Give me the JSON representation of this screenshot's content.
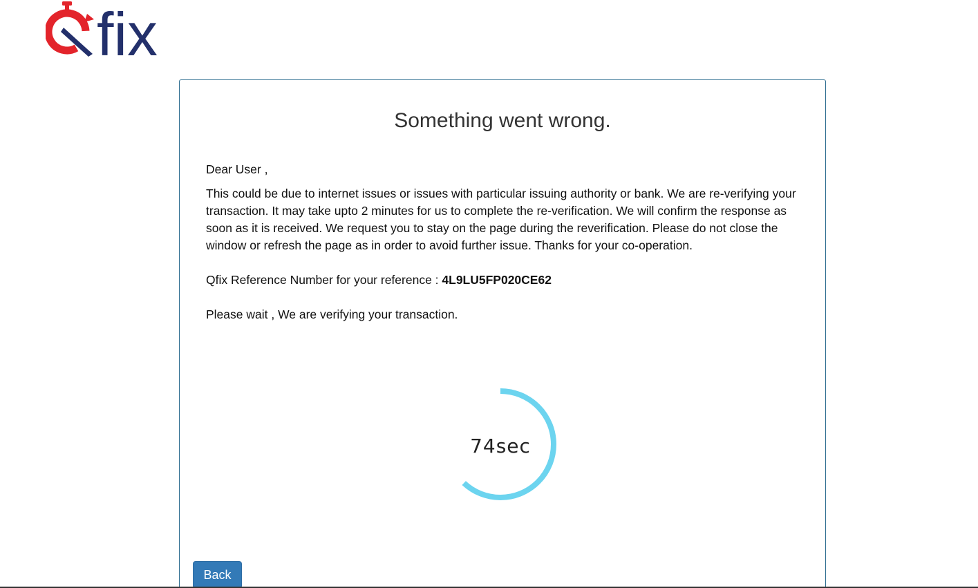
{
  "logo": {
    "text": "fix",
    "brand_red": "#e3242b",
    "brand_navy": "#23306b"
  },
  "card": {
    "title": "Something went wrong.",
    "greeting": "Dear User ,",
    "message": "This could be due to internet issues or issues with particular issuing authority or bank. We are re-verifying your transaction. It may take upto 2 minutes for us to complete the re-verification. We will confirm the response as soon as it is received. We request you to stay on the page during the reverification. Please do not close the window or refresh the page as in order to avoid further issue. Thanks for your co-operation.",
    "reference_label": "Qfix Reference Number for your reference : ",
    "reference_number": "4L9LU5FP020CE62",
    "wait_message": "Please wait , We are verifying your transaction.",
    "border_color": "#2f6e91"
  },
  "timer": {
    "label": "74sec",
    "remaining_fraction": 0.62,
    "ring_color": "#6cd4ef"
  },
  "back_button": {
    "label": "Back",
    "color": "#337ab7"
  }
}
